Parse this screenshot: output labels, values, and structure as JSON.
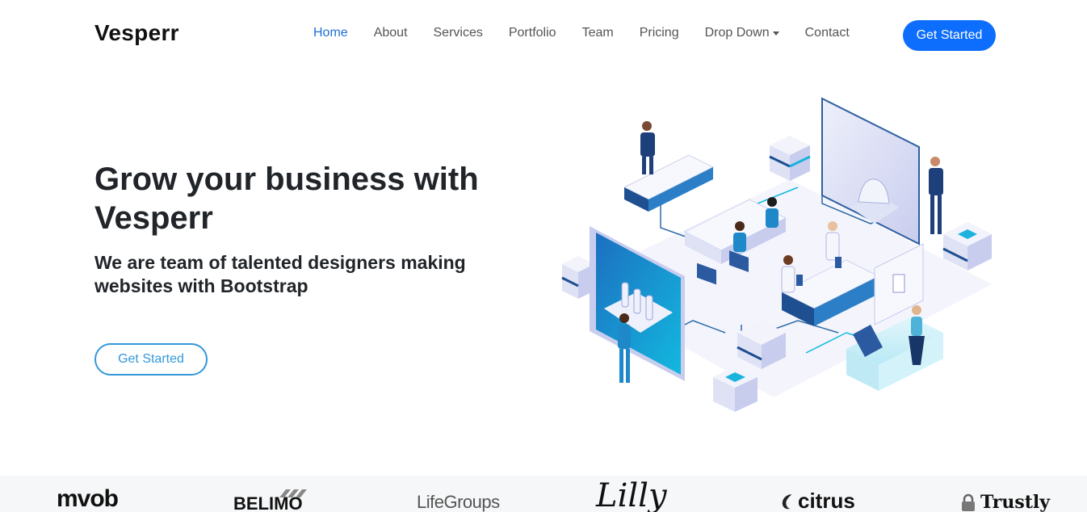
{
  "header": {
    "brand": "Vesperr",
    "nav": [
      {
        "label": "Home",
        "active": true
      },
      {
        "label": "About"
      },
      {
        "label": "Services"
      },
      {
        "label": "Portfolio"
      },
      {
        "label": "Team"
      },
      {
        "label": "Pricing"
      },
      {
        "label": "Drop Down",
        "dropdown": true
      },
      {
        "label": "Contact"
      }
    ],
    "cta": "Get Started"
  },
  "hero": {
    "title": "Grow your business with Vesperr",
    "subtitle": "We are team of talented designers making websites with Bootstrap",
    "cta": "Get Started"
  },
  "clients": [
    {
      "name": "mvob"
    },
    {
      "name": "BELIMO"
    },
    {
      "name": "LifeGroups"
    },
    {
      "name": "Lilly"
    },
    {
      "name": "citrus"
    },
    {
      "name": "Trustly"
    }
  ],
  "colors": {
    "accent": "#0d6efd",
    "active_nav": "#1f6fd6",
    "hero_button": "#3498db",
    "clients_bg": "#f6f7f8"
  }
}
